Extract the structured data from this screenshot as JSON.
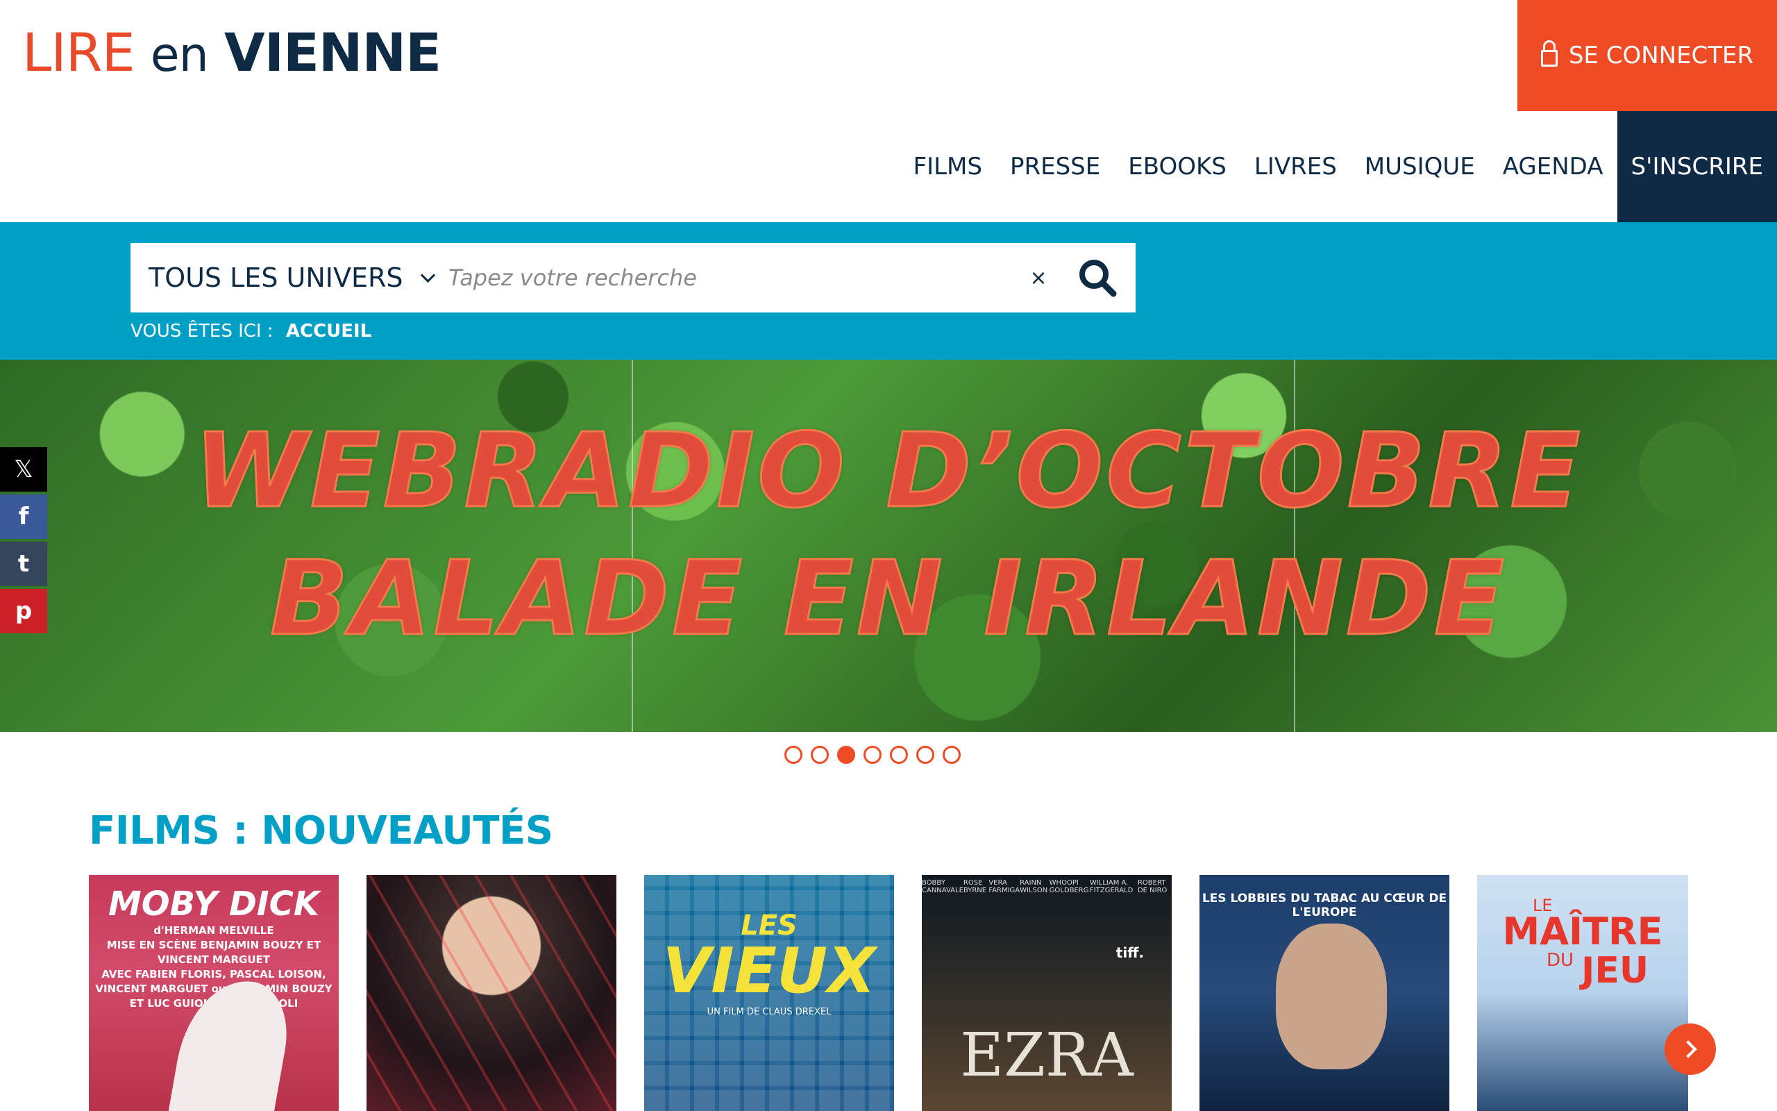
{
  "header": {
    "logo": {
      "lire": "LIRE",
      "en": "en",
      "vienne": "VIENNE"
    },
    "login_label": "SE CONNECTER"
  },
  "nav": {
    "items": [
      {
        "label": "FILMS"
      },
      {
        "label": "PRESSE"
      },
      {
        "label": "EBOOKS"
      },
      {
        "label": "LIVRES"
      },
      {
        "label": "MUSIQUE"
      },
      {
        "label": "AGENDA"
      }
    ],
    "signup_label": "S'INSCRIRE"
  },
  "search": {
    "universe": "TOUS LES UNIVERS",
    "placeholder": "Tapez votre recherche",
    "clear_glyph": "×"
  },
  "breadcrumb": {
    "prefix": "VOUS ÊTES ICI :",
    "current": "ACCUEIL"
  },
  "social": {
    "x": "𝕏",
    "facebook": "f",
    "tumblr": "t",
    "pinterest": "p"
  },
  "banner": {
    "line1": "WEBRADIO D’OCTOBRE",
    "line2": "BALADE EN IRLANDE"
  },
  "carousel": {
    "dot_count": 7,
    "active_index": 2
  },
  "films": {
    "title": "FILMS : NOUVEAUTÉS",
    "posters": [
      {
        "title": "MOBY DICK",
        "credit1": "d'HERMAN MELVILLE",
        "credit2": "MISE EN SCÈNE BENJAMIN BOUZY ET VINCENT MARGUET",
        "credit3": "AVEC FABIEN FLORIS, PASCAL LOISON,",
        "credit4": "VINCENT MARGUET ou BENJAMIN BOUZY",
        "credit5": "ET LUC GUIOL ou KEVIN POLI"
      },
      {
        "title": ""
      },
      {
        "les": "LES",
        "title": "VIEUX",
        "credit": "UN FILM DE CLAUS DREXEL"
      },
      {
        "cast": [
          "BOBBY CANNAVALE",
          "ROSE BYRNE",
          "VERA FARMIGA",
          "RAINN WILSON",
          "WHOOPI GOLDBERG",
          "WILLIAM A. FITZGERALD",
          "ROBERT DE NIRO"
        ],
        "badge": "tiff.",
        "title": "EZRA"
      },
      {
        "title": "LES LOBBIES DU TABAC AU CŒUR DE L'EUROPE"
      },
      {
        "le": "LE",
        "title": "MAÎTRE",
        "du": "DU",
        "jeu": "JEU"
      }
    ]
  },
  "colors": {
    "brand_orange": "#ef4b25",
    "brand_navy": "#0f2a44",
    "brand_cyan": "#00a0c6"
  }
}
